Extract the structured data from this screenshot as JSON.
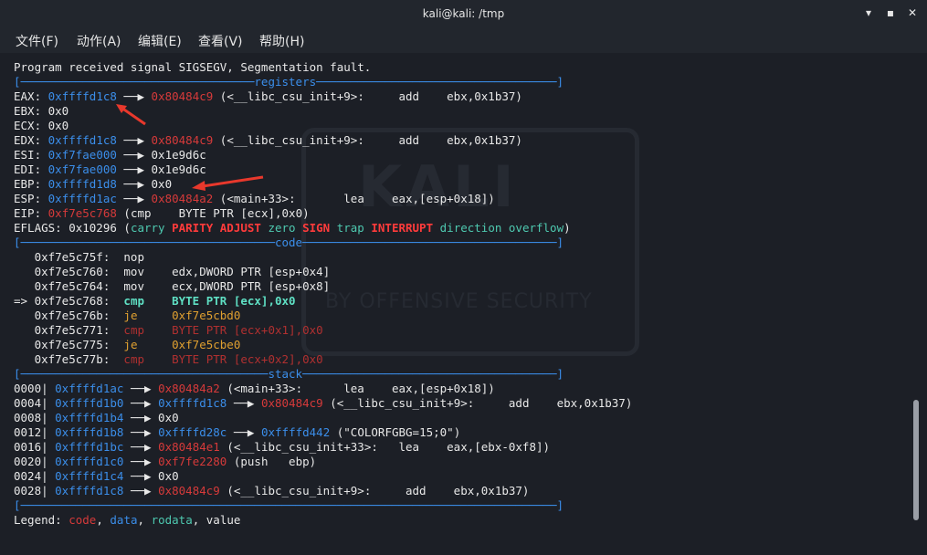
{
  "window": {
    "title": "kali@kali: /tmp"
  },
  "menu": [
    {
      "label": "文件(F)"
    },
    {
      "label": "动作(A)"
    },
    {
      "label": "编辑(E)"
    },
    {
      "label": "查看(V)"
    },
    {
      "label": "帮助(H)"
    }
  ],
  "watermark": {
    "text": "KALI",
    "sub": "BY OFFENSIVE SECURITY"
  },
  "lines": [
    [
      {
        "t": "Program received signal SIGSEGV, Segmentation fault.",
        "c": "white"
      }
    ],
    [
      {
        "t": "[──────────────────────────────────registers───────────────────────────────────]",
        "c": "blue"
      }
    ],
    [
      {
        "t": "EAX: ",
        "c": "white"
      },
      {
        "t": "0xffffd1c8",
        "c": "blue"
      },
      {
        "t": " ──▶ ",
        "c": "white"
      },
      {
        "t": "0x80484c9",
        "c": "red"
      },
      {
        "t": " (<__libc_csu_init+9>:     add    ebx,0x1b37)",
        "c": "white"
      }
    ],
    [
      {
        "t": "EBX: 0x0",
        "c": "white"
      }
    ],
    [
      {
        "t": "ECX: 0x0",
        "c": "white"
      }
    ],
    [
      {
        "t": "EDX: ",
        "c": "white"
      },
      {
        "t": "0xffffd1c8",
        "c": "blue"
      },
      {
        "t": " ──▶ ",
        "c": "white"
      },
      {
        "t": "0x80484c9",
        "c": "red"
      },
      {
        "t": " (<__libc_csu_init+9>:     add    ebx,0x1b37)",
        "c": "white"
      }
    ],
    [
      {
        "t": "ESI: ",
        "c": "white"
      },
      {
        "t": "0xf7fae000",
        "c": "blue"
      },
      {
        "t": " ──▶ 0x1e9d6c",
        "c": "white"
      }
    ],
    [
      {
        "t": "EDI: ",
        "c": "white"
      },
      {
        "t": "0xf7fae000",
        "c": "blue"
      },
      {
        "t": " ──▶ 0x1e9d6c",
        "c": "white"
      }
    ],
    [
      {
        "t": "EBP: ",
        "c": "white"
      },
      {
        "t": "0xffffd1d8",
        "c": "blue"
      },
      {
        "t": " ──▶ 0x0",
        "c": "white"
      }
    ],
    [
      {
        "t": "ESP: ",
        "c": "white"
      },
      {
        "t": "0xffffd1ac",
        "c": "blue"
      },
      {
        "t": " ──▶ ",
        "c": "white"
      },
      {
        "t": "0x80484a2",
        "c": "red"
      },
      {
        "t": " (<main+33>:       lea    eax,[esp+0x18])",
        "c": "white"
      }
    ],
    [
      {
        "t": "EIP: ",
        "c": "white"
      },
      {
        "t": "0xf7e5c768",
        "c": "red"
      },
      {
        "t": " (cmp    BYTE PTR [ecx],0x0)",
        "c": "white"
      }
    ],
    [
      {
        "t": "EFLAGS: 0x10296 (",
        "c": "white"
      },
      {
        "t": "carry ",
        "c": "green"
      },
      {
        "t": "PARITY ADJUST ",
        "c": "boldred"
      },
      {
        "t": "zero ",
        "c": "green"
      },
      {
        "t": "SIGN ",
        "c": "boldred"
      },
      {
        "t": "trap ",
        "c": "green"
      },
      {
        "t": "INTERRUPT ",
        "c": "boldred"
      },
      {
        "t": "direction overflow",
        "c": "green"
      },
      {
        "t": ")",
        "c": "white"
      }
    ],
    [
      {
        "t": "[─────────────────────────────────────code─────────────────────────────────────]",
        "c": "blue"
      }
    ],
    [
      {
        "t": "   0xf7e5c75f:  nop",
        "c": "white"
      }
    ],
    [
      {
        "t": "   0xf7e5c760:  mov    edx,DWORD PTR [esp+0x4]",
        "c": "white"
      }
    ],
    [
      {
        "t": "   0xf7e5c764:  mov    ecx,DWORD PTR [esp+0x8]",
        "c": "white"
      }
    ],
    [
      {
        "t": "=> 0xf7e5c768:  ",
        "c": "white"
      },
      {
        "t": "cmp    BYTE PTR [ecx],0x0",
        "c": "boldgreen"
      }
    ],
    [
      {
        "t": "   0xf7e5c76b:  ",
        "c": "white"
      },
      {
        "t": "je     0xf7e5cbd0",
        "c": "orange"
      }
    ],
    [
      {
        "t": "   0xf7e5c771:  ",
        "c": "white"
      },
      {
        "t": "cmp    BYTE PTR [ecx+0x1],0x0",
        "c": "dimred"
      }
    ],
    [
      {
        "t": "   0xf7e5c775:  ",
        "c": "white"
      },
      {
        "t": "je     0xf7e5cbe0",
        "c": "orange"
      }
    ],
    [
      {
        "t": "   0xf7e5c77b:  ",
        "c": "white"
      },
      {
        "t": "cmp    BYTE PTR [ecx+0x2],0x0",
        "c": "dimred"
      }
    ],
    [
      {
        "t": "[────────────────────────────────────stack─────────────────────────────────────]",
        "c": "blue"
      }
    ],
    [
      {
        "t": "0000| ",
        "c": "white"
      },
      {
        "t": "0xffffd1ac",
        "c": "blue"
      },
      {
        "t": " ──▶ ",
        "c": "white"
      },
      {
        "t": "0x80484a2",
        "c": "red"
      },
      {
        "t": " (<main+33>:      lea    eax,[esp+0x18])",
        "c": "white"
      }
    ],
    [
      {
        "t": "0004| ",
        "c": "white"
      },
      {
        "t": "0xffffd1b0",
        "c": "blue"
      },
      {
        "t": " ──▶ ",
        "c": "white"
      },
      {
        "t": "0xffffd1c8",
        "c": "blue"
      },
      {
        "t": " ──▶ ",
        "c": "white"
      },
      {
        "t": "0x80484c9",
        "c": "red"
      },
      {
        "t": " (<__libc_csu_init+9>:     add    ebx,0x1b37)",
        "c": "white"
      }
    ],
    [
      {
        "t": "0008| ",
        "c": "white"
      },
      {
        "t": "0xffffd1b4",
        "c": "blue"
      },
      {
        "t": " ──▶ 0x0",
        "c": "white"
      }
    ],
    [
      {
        "t": "0012| ",
        "c": "white"
      },
      {
        "t": "0xffffd1b8",
        "c": "blue"
      },
      {
        "t": " ──▶ ",
        "c": "white"
      },
      {
        "t": "0xffffd28c",
        "c": "blue"
      },
      {
        "t": " ──▶ ",
        "c": "white"
      },
      {
        "t": "0xffffd442",
        "c": "blue"
      },
      {
        "t": " (\"COLORFGBG=15;0\")",
        "c": "white"
      }
    ],
    [
      {
        "t": "0016| ",
        "c": "white"
      },
      {
        "t": "0xffffd1bc",
        "c": "blue"
      },
      {
        "t": " ──▶ ",
        "c": "white"
      },
      {
        "t": "0x80484e1",
        "c": "red"
      },
      {
        "t": " (<__libc_csu_init+33>:   lea    eax,[ebx-0xf8])",
        "c": "white"
      }
    ],
    [
      {
        "t": "0020| ",
        "c": "white"
      },
      {
        "t": "0xffffd1c0",
        "c": "blue"
      },
      {
        "t": " ──▶ ",
        "c": "white"
      },
      {
        "t": "0xf7fe2280",
        "c": "red"
      },
      {
        "t": " (push   ebp)",
        "c": "white"
      }
    ],
    [
      {
        "t": "0024| ",
        "c": "white"
      },
      {
        "t": "0xffffd1c4",
        "c": "blue"
      },
      {
        "t": " ──▶ 0x0",
        "c": "white"
      }
    ],
    [
      {
        "t": "0028| ",
        "c": "white"
      },
      {
        "t": "0xffffd1c8",
        "c": "blue"
      },
      {
        "t": " ──▶ ",
        "c": "white"
      },
      {
        "t": "0x80484c9",
        "c": "red"
      },
      {
        "t": " (<__libc_csu_init+9>:     add    ebx,0x1b37)",
        "c": "white"
      }
    ],
    [
      {
        "t": "[──────────────────────────────────────────────────────────────────────────────]",
        "c": "blue"
      }
    ],
    [
      {
        "t": "Legend: ",
        "c": "white"
      },
      {
        "t": "code",
        "c": "red"
      },
      {
        "t": ", ",
        "c": "white"
      },
      {
        "t": "data",
        "c": "blue"
      },
      {
        "t": ", ",
        "c": "white"
      },
      {
        "t": "rodata",
        "c": "green"
      },
      {
        "t": ", value",
        "c": "white"
      }
    ]
  ]
}
